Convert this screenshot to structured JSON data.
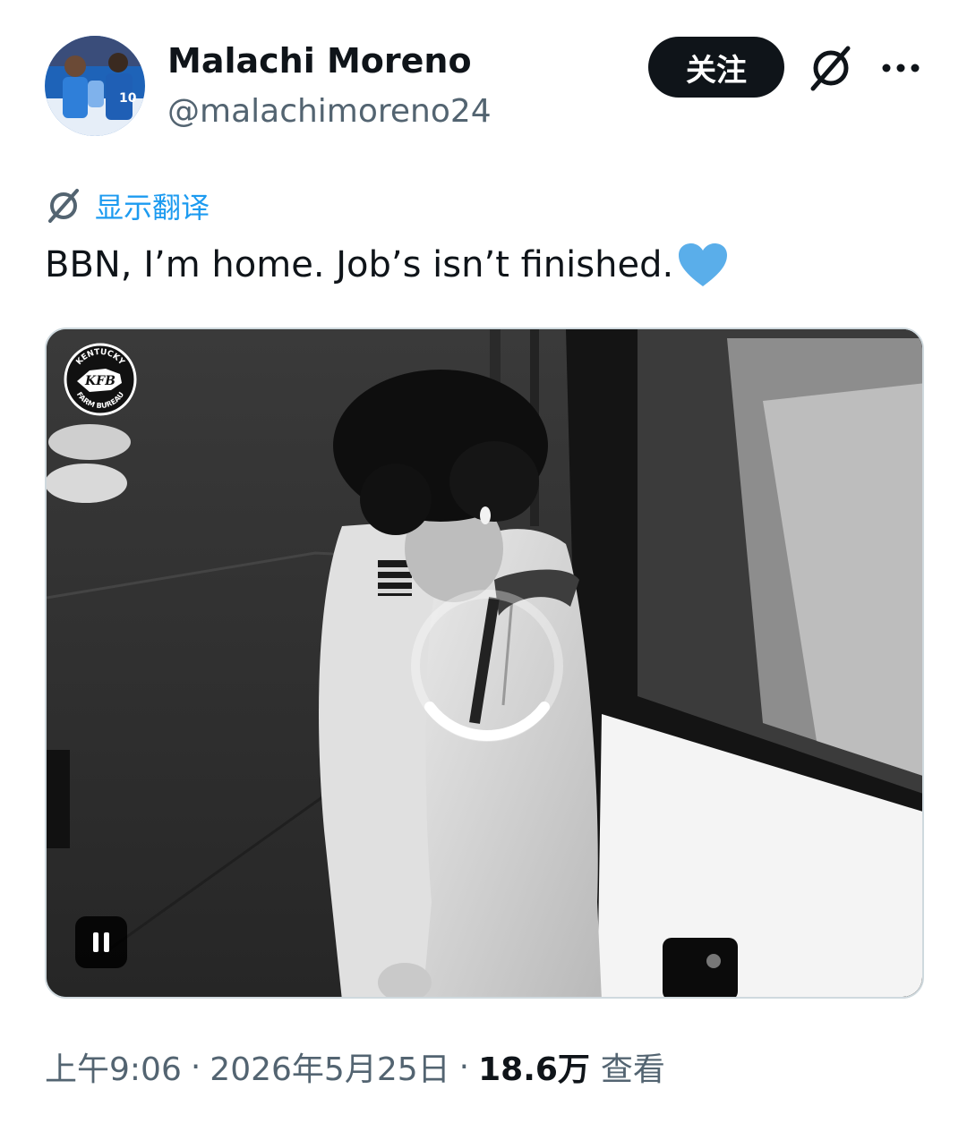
{
  "user": {
    "display_name": "Malachi Moreno",
    "handle": "@malachimoreno24",
    "avatar_icon": "avatar-photo"
  },
  "actions": {
    "follow_label": "关注",
    "grok_icon": "grok-icon",
    "more_icon": "more-icon"
  },
  "translate": {
    "label": "显示翻译",
    "icon": "grok-icon"
  },
  "tweet": {
    "text": "BBN, I’m home. Job’s isn’t finished.",
    "emoji": "blue-heart"
  },
  "media": {
    "type": "video",
    "logo_icon": "kfb-logo",
    "logo_text_top": "KENTUCKY",
    "logo_text_center": "KFB",
    "logo_text_bottom": "FARM BUREAU",
    "state": "loading",
    "control_icon": "pause-icon"
  },
  "meta": {
    "time": "上午9:06",
    "date": "2026年5月25日",
    "separator": "·",
    "views_count": "18.6万",
    "views_label": "查看"
  },
  "colors": {
    "text_primary": "#0f1419",
    "text_secondary": "#536471",
    "link": "#1d9bf0",
    "heart": "#5aaeea"
  }
}
